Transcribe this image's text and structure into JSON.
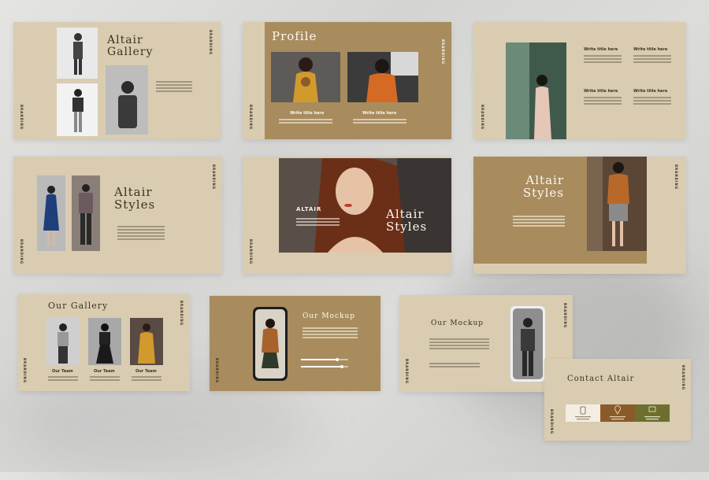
{
  "brand_vertical": "BRANDING",
  "slides": {
    "gallery": {
      "title_line1": "Altair",
      "title_line2": "Gallery"
    },
    "profile": {
      "title": "Profile",
      "caption_left": "Write title here",
      "caption_right": "Write title here"
    },
    "info": {
      "heading_1": "Write title here",
      "heading_2": "Write title here",
      "heading_3": "Write title here",
      "heading_4": "Write title here"
    },
    "styles_left": {
      "title_line1": "Altair",
      "title_line2": "Styles"
    },
    "hero": {
      "small_label": "ALTAIR",
      "title_line1": "Altair",
      "title_line2": "Styles"
    },
    "styles_right": {
      "title_line1": "Altair",
      "title_line2": "Styles"
    },
    "our_gallery": {
      "title": "Our Gallery",
      "team_1": "Our Team",
      "team_2": "Our Team",
      "team_3": "Our Team"
    },
    "mockup_gold": {
      "title": "Our Mockup"
    },
    "mockup_cream": {
      "title": "Our Mockup"
    },
    "contact": {
      "title": "Contact Altair"
    }
  },
  "colors": {
    "cream": "#d9ccb1",
    "gold": "#a88c5e",
    "brown": "#8a5a2b",
    "olive": "#6e6f2e"
  }
}
